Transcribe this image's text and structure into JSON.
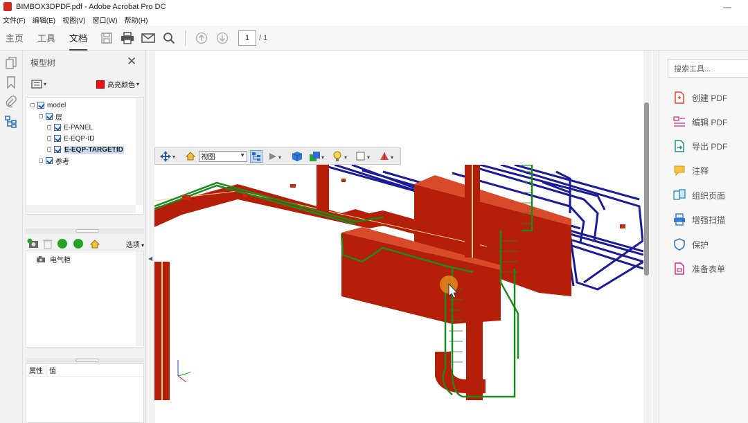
{
  "window": {
    "title": "BIMBOX3DPDF.pdf - Adobe Acrobat Pro DC",
    "minimize": "—"
  },
  "menu": [
    "文件(F)",
    "编辑(E)",
    "视图(V)",
    "窗口(W)",
    "帮助(H)"
  ],
  "tabs": {
    "home": "主页",
    "tools": "工具",
    "document": "文档"
  },
  "page_nav": {
    "current": "1",
    "total": "/ 1"
  },
  "model_tree": {
    "title": "模型树",
    "highlight_label": "高亮颜色",
    "highlight_color": "#ee1111",
    "nodes": {
      "root": "model",
      "layer": "层",
      "panel": "E-PANEL",
      "eqp_id": "E-EQP-ID",
      "target": "E-EQP-TARGETID",
      "ref": "参考"
    },
    "views_options": "选项",
    "views": [
      "电气柜"
    ],
    "props": {
      "col_property": "属性",
      "col_value": "值"
    }
  },
  "toolbar3d": {
    "view_select": "视图"
  },
  "right_pane": {
    "search_placeholder": "搜索工具...",
    "tools": [
      "创建 PDF",
      "编辑 PDF",
      "导出 PDF",
      "注释",
      "组织页面",
      "增强扫描",
      "保护",
      "准备表单"
    ]
  },
  "colors": {
    "pipe_red": "#b51e08",
    "tray_green": "#1e8a1e",
    "tray_blue": "#1a1a9a",
    "cursor_marker": "#e38a1a"
  }
}
